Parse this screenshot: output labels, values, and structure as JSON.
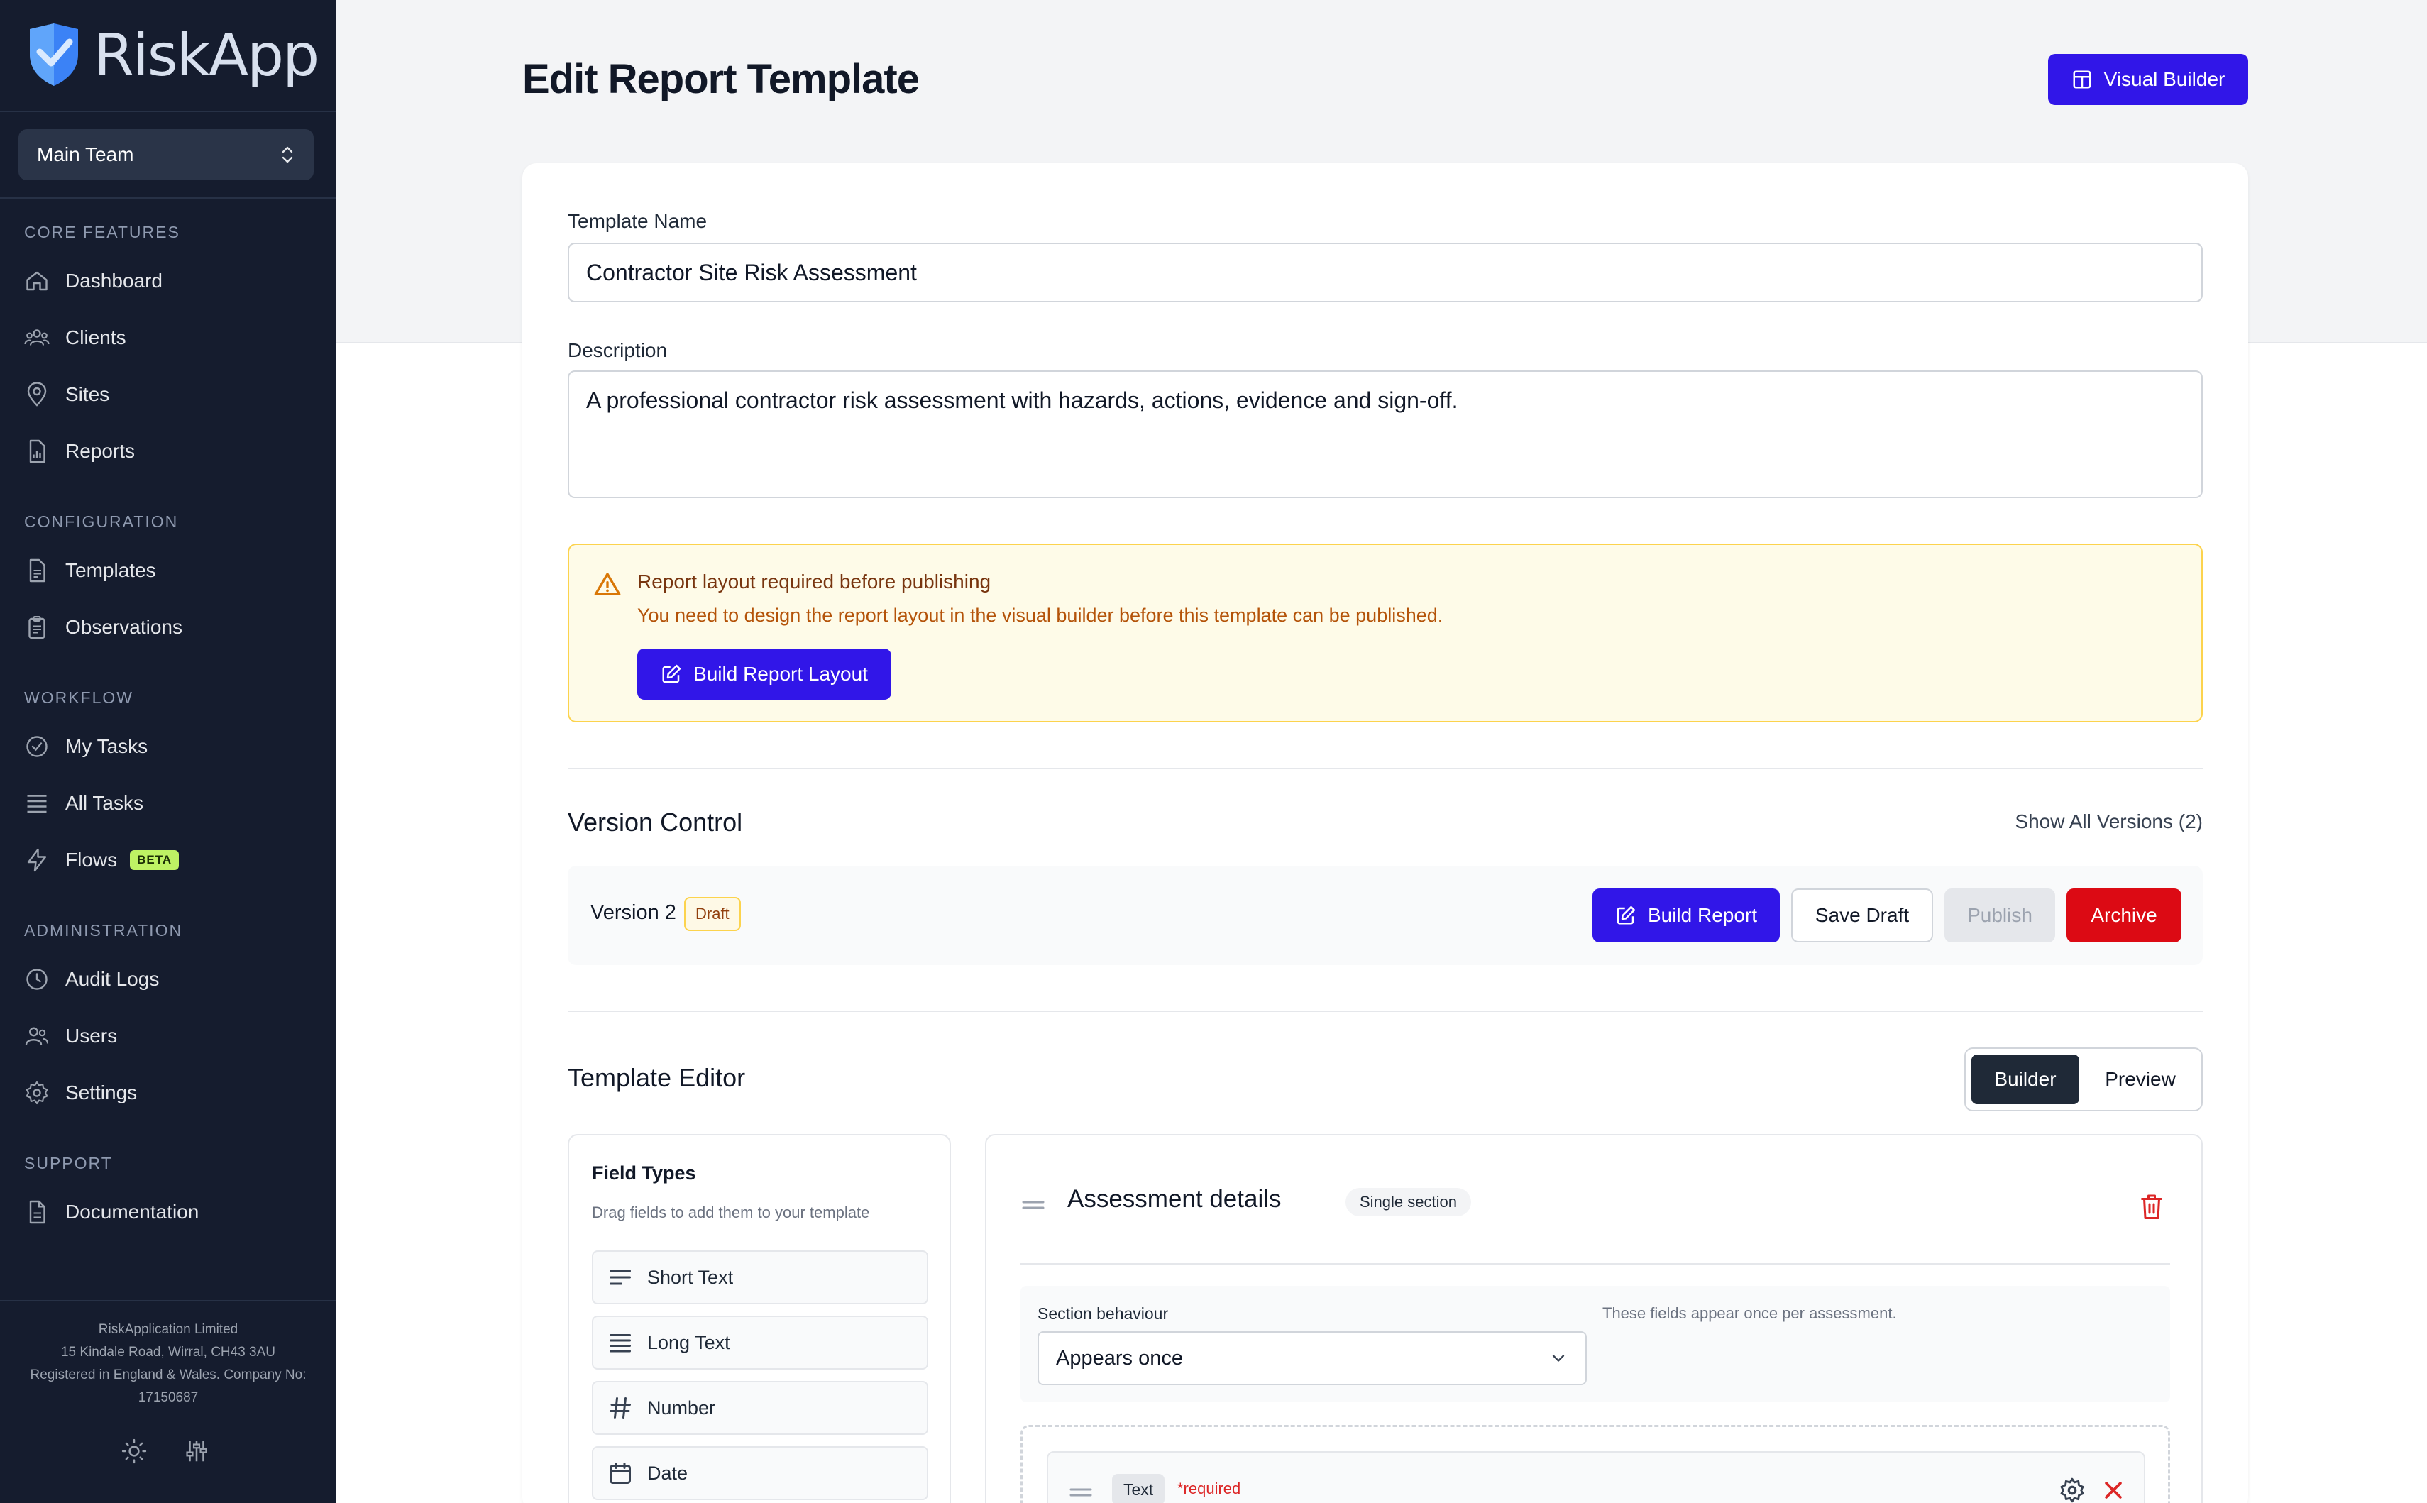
{
  "brand": {
    "name": "RiskApp"
  },
  "team_select": {
    "value": "Main Team"
  },
  "nav": {
    "sections": [
      {
        "title": "CORE FEATURES"
      },
      {
        "title": "CONFIGURATION"
      },
      {
        "title": "WORKFLOW"
      },
      {
        "title": "ADMINISTRATION"
      },
      {
        "title": "SUPPORT"
      }
    ],
    "items": [
      {
        "label": "Dashboard",
        "icon": "home-icon"
      },
      {
        "label": "Clients",
        "icon": "users-group-icon"
      },
      {
        "label": "Sites",
        "icon": "map-pin-icon"
      },
      {
        "label": "Reports",
        "icon": "report-file-icon"
      },
      {
        "label": "Templates",
        "icon": "template-file-icon"
      },
      {
        "label": "Observations",
        "icon": "clipboard-icon"
      },
      {
        "label": "My Tasks",
        "icon": "check-circle-icon"
      },
      {
        "label": "All Tasks",
        "icon": "list-icon"
      },
      {
        "label": "Flows",
        "icon": "lightning-icon",
        "badge": "BETA"
      },
      {
        "label": "Audit Logs",
        "icon": "clock-icon"
      },
      {
        "label": "Users",
        "icon": "users-icon"
      },
      {
        "label": "Settings",
        "icon": "gear-icon"
      },
      {
        "label": "Documentation",
        "icon": "document-icon"
      }
    ]
  },
  "footer": {
    "line1": "RiskApplication Limited",
    "line2": "15 Kindale Road, Wirral, CH43 3AU",
    "line3": "Registered in England & Wales. Company No:",
    "line4": "17150687"
  },
  "page": {
    "title": "Edit Report Template",
    "visual_builder_label": "Visual Builder"
  },
  "form": {
    "name_label": "Template Name",
    "name_value": "Contractor Site Risk Assessment",
    "description_label": "Description",
    "description_value": "A professional contractor risk assessment with hazards, actions, evidence and sign-off."
  },
  "alert": {
    "title": "Report layout required before publishing",
    "message": "You need to design the report layout in the visual builder before this template can be published.",
    "button_label": "Build Report Layout"
  },
  "version_control": {
    "title": "Version Control",
    "show_all": "Show All Versions (2)",
    "version_label": "Version 2",
    "status": "Draft",
    "build_report": "Build Report",
    "save_draft": "Save Draft",
    "publish": "Publish",
    "archive": "Archive"
  },
  "editor": {
    "title": "Template Editor",
    "toggle_builder": "Builder",
    "toggle_preview": "Preview"
  },
  "field_types": {
    "title": "Field Types",
    "subtitle": "Drag fields to add them to your template",
    "items": [
      {
        "label": "Short Text",
        "icon": "short-text-icon"
      },
      {
        "label": "Long Text",
        "icon": "long-text-icon"
      },
      {
        "label": "Number",
        "icon": "hash-icon"
      },
      {
        "label": "Date",
        "icon": "calendar-icon"
      }
    ]
  },
  "section": {
    "title": "Assessment details",
    "badge": "Single section",
    "behaviour_label": "Section behaviour",
    "behaviour_value": "Appears once",
    "behaviour_help": "These fields appear once per assessment.",
    "field_type": "Text",
    "required": "*required"
  },
  "colors": {
    "sidebar_bg": "#151c2e",
    "primary": "#3116e8",
    "danger": "#dc0a14",
    "beta_badge": "#bef264"
  }
}
